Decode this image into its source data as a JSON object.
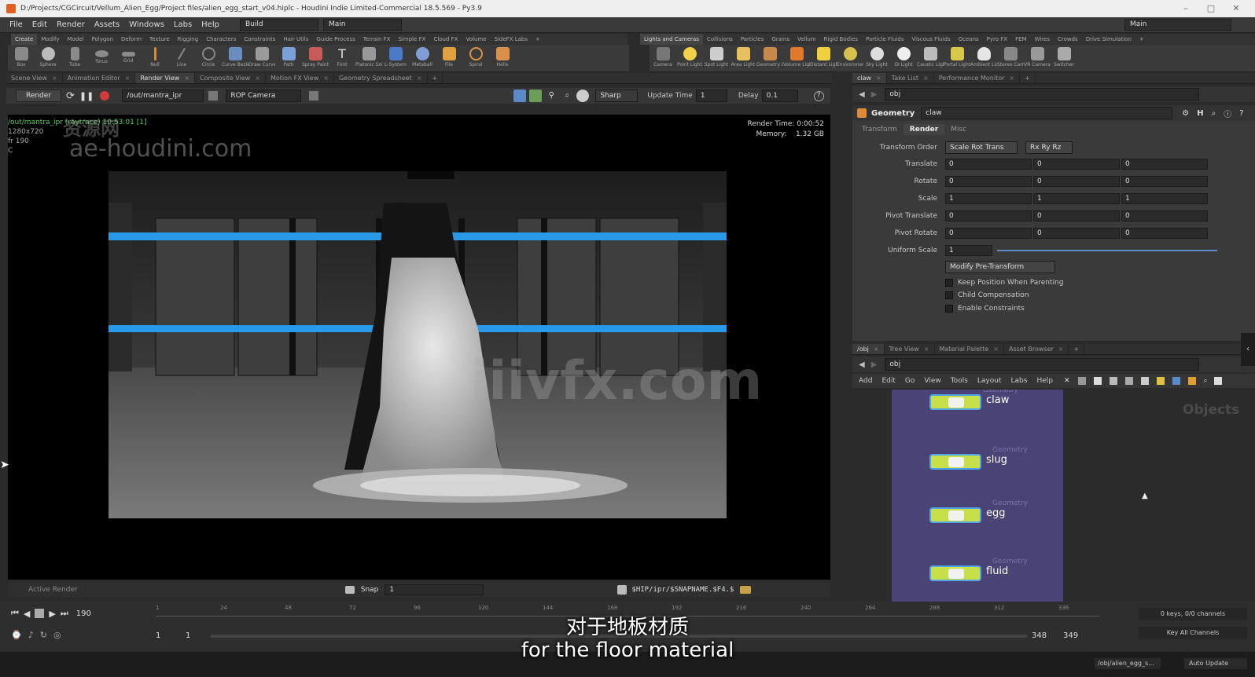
{
  "window": {
    "title": "D:/Projects/CGCircuit/Vellum_Alien_Egg/Project files/alien_egg_start_v04.hiplc - Houdini Indie Limited-Commercial 18.5.569 - Py3.9"
  },
  "menubar": {
    "items": [
      "File",
      "Edit",
      "Render",
      "Assets",
      "Windows",
      "Labs",
      "Help"
    ],
    "desktop_build": "Build",
    "desktop_main": "Main",
    "desktop_main_right": "Main"
  },
  "shelf_left": {
    "tabs": [
      "Create",
      "Modify",
      "Model",
      "Polygon",
      "Deform",
      "Texture",
      "Rigging",
      "Characters",
      "Constraints",
      "Hair Utils",
      "Guide Process",
      "Terrain FX",
      "Simple FX",
      "Cloud FX",
      "Volume",
      "SideFX Labs"
    ],
    "tools": [
      "Box",
      "Sphere",
      "Tube",
      "Torus",
      "Grid",
      "Null",
      "Line",
      "Circle",
      "Curve Bezier",
      "Draw Curve",
      "Path",
      "Spray Paint",
      "Font",
      "Platonic Solids",
      "L-System",
      "Metaball",
      "File",
      "Spiral",
      "Helix"
    ]
  },
  "shelf_right": {
    "tabs": [
      "Lights and Cameras",
      "Collisions",
      "Particles",
      "Grains",
      "Vellum",
      "Rigid Bodies",
      "Particle Fluids",
      "Viscous Fluids",
      "Oceans",
      "Pyro FX",
      "FEM",
      "Wires",
      "Crowds",
      "Drive Simulation"
    ],
    "tools": [
      "Camera",
      "Point Light",
      "Spot Light",
      "Area Light",
      "Geometry Light",
      "Volume Light",
      "Distant Light",
      "Environment Light",
      "Sky Light",
      "GI Light",
      "Caustic Light",
      "Portal Light",
      "Ambient Light",
      "Stereo Camera",
      "VR Camera",
      "Switcher"
    ]
  },
  "viewer_tabs": [
    "Scene View",
    "Animation Editor",
    "Render View",
    "Composite View",
    "Motion FX View",
    "Geometry Spreadsheet"
  ],
  "render_toolbar": {
    "render_label": "Render",
    "rop_path": "/out/mantra_ipr",
    "camera": "ROP Camera",
    "sharp": "Sharp",
    "update_time_label": "Update Time",
    "update_time_value": "1",
    "delay_label": "Delay",
    "delay_value": "0.1"
  },
  "viewport": {
    "overlay_path": "/out/mantra_ipr (raytrace) 10:53:01 [1]",
    "resolution": "1280x720",
    "frame": "fr 190",
    "channel": "C",
    "render_time_label": "Render Time:",
    "render_time_value": "0:00:52",
    "memory_label": "Memory:",
    "memory_value": "1.32 GB",
    "watermark_cn": "资源网",
    "watermark_url": "ae-houdini.com",
    "watermark_center": "iiivfx.com"
  },
  "render_strip": {
    "active_render": "Active Render",
    "snap_label": "Snap",
    "snap_value": "1",
    "output_path": "$HIP/ipr/$SNAPNAME.$F4.$"
  },
  "param_tabs": [
    "claw",
    "Take List",
    "Performance Monitor"
  ],
  "param_path": "obj",
  "param_node": {
    "type": "Geometry",
    "name": "claw",
    "tabs": [
      "Transform",
      "Render",
      "Misc"
    ],
    "transform_order_label": "Transform Order",
    "transform_order": "Scale Rot Trans",
    "rot_order": "Rx Ry Rz",
    "rows": [
      {
        "label": "Translate",
        "values": [
          "0",
          "0",
          "0"
        ]
      },
      {
        "label": "Rotate",
        "values": [
          "0",
          "0",
          "0"
        ]
      },
      {
        "label": "Scale",
        "values": [
          "1",
          "1",
          "1"
        ]
      },
      {
        "label": "Pivot Translate",
        "values": [
          "0",
          "0",
          "0"
        ]
      },
      {
        "label": "Pivot Rotate",
        "values": [
          "0",
          "0",
          "0"
        ]
      }
    ],
    "uniform_scale_label": "Uniform Scale",
    "uniform_scale": "1",
    "modify_pre_transform": "Modify Pre-Transform",
    "checkboxes": [
      "Keep Position When Parenting",
      "Child Compensation",
      "Enable Constraints"
    ]
  },
  "network_tabs": [
    "/obj",
    "Tree View",
    "Material Palette",
    "Asset Browser"
  ],
  "network_path": "obj",
  "network_menu": [
    "Add",
    "Edit",
    "Go",
    "View",
    "Tools",
    "Layout",
    "Labs",
    "Help"
  ],
  "network_context": "Objects",
  "nodes": [
    {
      "type": "Geometry",
      "name": "claw"
    },
    {
      "type": "Geometry",
      "name": "slug"
    },
    {
      "type": "Geometry",
      "name": "egg"
    },
    {
      "type": "Geometry",
      "name": "fluid"
    }
  ],
  "timeline": {
    "current_frame": "190",
    "ticks": [
      "1",
      "24",
      "48",
      "72",
      "96",
      "120",
      "144",
      "168",
      "192",
      "216",
      "240",
      "264",
      "288",
      "312",
      "336"
    ],
    "start": "1",
    "start2": "1",
    "end": "348",
    "end2": "349",
    "keys_info": "0 keys, 0/0 channels",
    "key_all": "Key All Channels"
  },
  "status": {
    "path": "/obj/alien_egg_s...",
    "auto_update": "Auto Update"
  },
  "subtitles": {
    "cn": "对于地板材质",
    "en": "for the floor material"
  }
}
